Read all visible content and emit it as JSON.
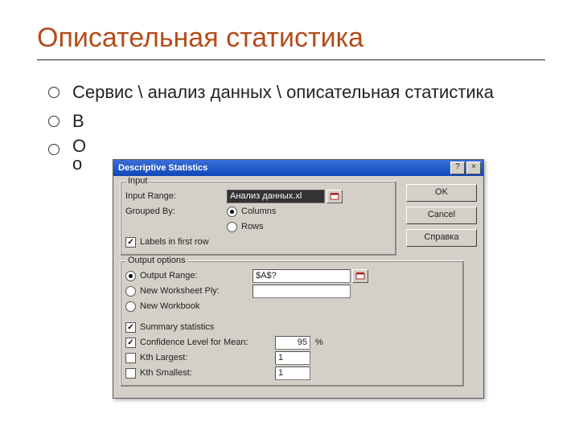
{
  "slide": {
    "title": "Описательная статистика",
    "bullets": [
      "Сервис \\ анализ данных \\ описательная статистика",
      "В",
      "О",
      "о"
    ]
  },
  "dialog": {
    "title": "Descriptive Statistics",
    "help_btn": "?",
    "close_btn": "×",
    "buttons": {
      "ok": "OK",
      "cancel": "Cancel",
      "help": "Справка"
    },
    "input_group": {
      "title": "Input",
      "input_range_label": "Input Range:",
      "input_range_value": "Анализ данных.xl",
      "grouped_by_label": "Grouped By:",
      "grouped_columns": "Columns",
      "grouped_rows": "Rows",
      "grouped_selected": "columns",
      "labels_first_row": "Labels in first row",
      "labels_checked": true
    },
    "output_group": {
      "title": "Output options",
      "output_range": "Output Range:",
      "output_range_value": "$A$?",
      "output_selected": "range",
      "new_ws": "New Worksheet Ply:",
      "new_wb": "New Workbook",
      "summary": "Summary statistics",
      "summary_checked": true,
      "conf": "Confidence Level for Mean:",
      "conf_checked": true,
      "conf_value": "95",
      "conf_unit": "%",
      "kth_largest": "Kth Largest:",
      "kth_largest_value": "1",
      "kth_largest_checked": false,
      "kth_smallest": "Kth Smallest:",
      "kth_smallest_value": "1",
      "kth_smallest_checked": false
    }
  }
}
